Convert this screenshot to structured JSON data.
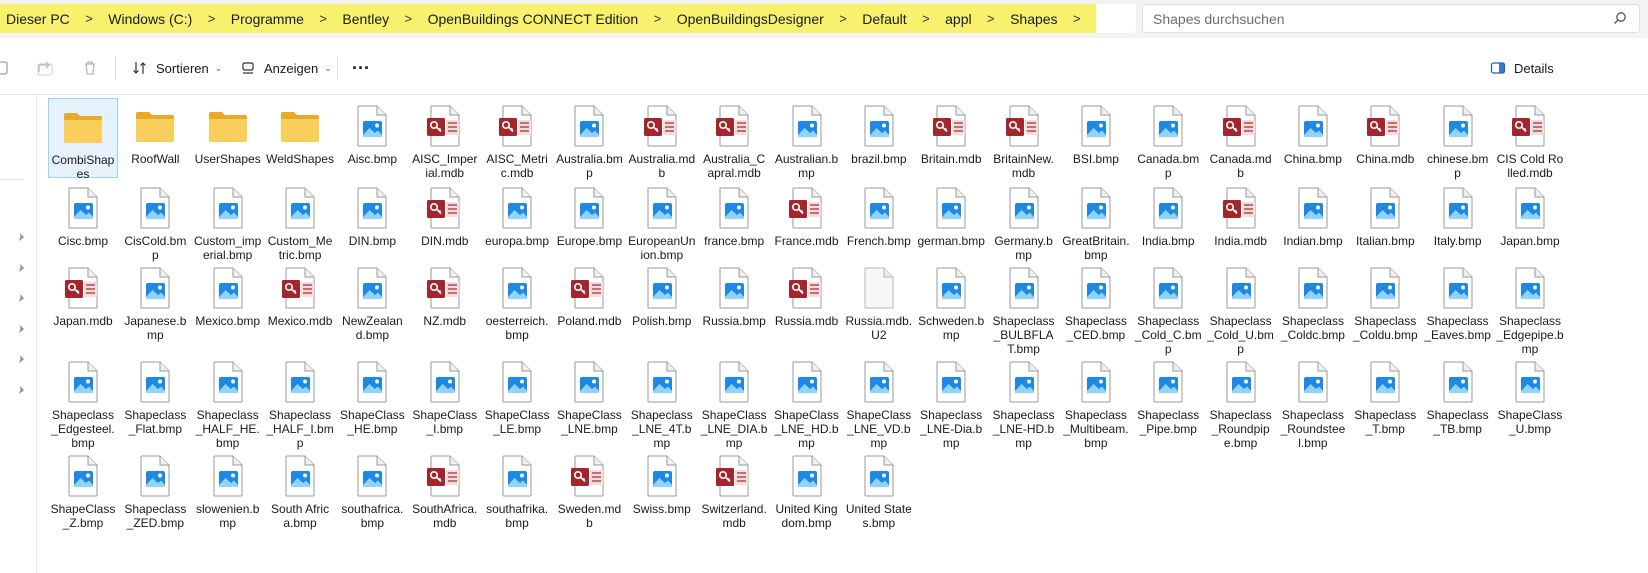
{
  "breadcrumb": [
    "Dieser PC",
    "Windows  (C:)",
    "Programme",
    "Bentley",
    "OpenBuildings CONNECT Edition",
    "OpenBuildingsDesigner",
    "Default",
    "appl",
    "Shapes"
  ],
  "search": {
    "placeholder": "Shapes durchsuchen"
  },
  "toolbar": {
    "sort_label": "Sortieren",
    "view_label": "Anzeigen",
    "more_label": "···",
    "details_label": "Details"
  },
  "colors": {
    "breadcrumb_highlight": "#f7f16d",
    "selected_bg": "#e5f1fb",
    "folder": "#f5c448",
    "image_icon": "#1e88e5",
    "mdb_icon": "#a4262c"
  },
  "files": [
    {
      "name": "CombiShapes",
      "type": "folder"
    },
    {
      "name": "RoofWall",
      "type": "folder"
    },
    {
      "name": "UserShapes",
      "type": "folder"
    },
    {
      "name": "WeldShapes",
      "type": "folder"
    },
    {
      "name": "Aisc.bmp",
      "type": "image"
    },
    {
      "name": "AISC_Imperial.mdb",
      "type": "mdb"
    },
    {
      "name": "AISC_Metric.mdb",
      "type": "mdb"
    },
    {
      "name": "Australia.bmp",
      "type": "image"
    },
    {
      "name": "Australia.mdb",
      "type": "mdb"
    },
    {
      "name": "Australia_Capral.mdb",
      "type": "mdb"
    },
    {
      "name": "Australian.bmp",
      "type": "image"
    },
    {
      "name": "brazil.bmp",
      "type": "image"
    },
    {
      "name": "Britain.mdb",
      "type": "mdb"
    },
    {
      "name": "BritainNew.mdb",
      "type": "mdb"
    },
    {
      "name": "BSI.bmp",
      "type": "image"
    },
    {
      "name": "Canada.bmp",
      "type": "image"
    },
    {
      "name": "Canada.mdb",
      "type": "mdb"
    },
    {
      "name": "China.bmp",
      "type": "image"
    },
    {
      "name": "China.mdb",
      "type": "mdb"
    },
    {
      "name": "chinese.bmp",
      "type": "image"
    },
    {
      "name": "CIS Cold Rolled.mdb",
      "type": "mdb"
    },
    {
      "name": "Cisc.bmp",
      "type": "image"
    },
    {
      "name": "CisCold.bmp",
      "type": "image"
    },
    {
      "name": "Custom_imperial.bmp",
      "type": "image"
    },
    {
      "name": "Custom_Metric.bmp",
      "type": "image"
    },
    {
      "name": "DIN.bmp",
      "type": "image"
    },
    {
      "name": "DIN.mdb",
      "type": "mdb"
    },
    {
      "name": "europa.bmp",
      "type": "image"
    },
    {
      "name": "Europe.bmp",
      "type": "image"
    },
    {
      "name": "EuropeanUnion.bmp",
      "type": "image"
    },
    {
      "name": "france.bmp",
      "type": "image"
    },
    {
      "name": "France.mdb",
      "type": "mdb"
    },
    {
      "name": "French.bmp",
      "type": "image"
    },
    {
      "name": "german.bmp",
      "type": "image"
    },
    {
      "name": "Germany.bmp",
      "type": "image"
    },
    {
      "name": "GreatBritain.bmp",
      "type": "image"
    },
    {
      "name": "India.bmp",
      "type": "image"
    },
    {
      "name": "India.mdb",
      "type": "mdb"
    },
    {
      "name": "Indian.bmp",
      "type": "image"
    },
    {
      "name": "Italian.bmp",
      "type": "image"
    },
    {
      "name": "Italy.bmp",
      "type": "image"
    },
    {
      "name": "Japan.bmp",
      "type": "image"
    },
    {
      "name": "Japan.mdb",
      "type": "mdb"
    },
    {
      "name": "Japanese.bmp",
      "type": "image"
    },
    {
      "name": "Mexico.bmp",
      "type": "image"
    },
    {
      "name": "Mexico.mdb",
      "type": "mdb"
    },
    {
      "name": "NewZealand.bmp",
      "type": "image"
    },
    {
      "name": "NZ.mdb",
      "type": "mdb"
    },
    {
      "name": "oesterreich.bmp",
      "type": "image"
    },
    {
      "name": "Poland.mdb",
      "type": "mdb"
    },
    {
      "name": "Polish.bmp",
      "type": "image"
    },
    {
      "name": "Russia.bmp",
      "type": "image"
    },
    {
      "name": "Russia.mdb",
      "type": "mdb"
    },
    {
      "name": "Russia.mdb.U2",
      "type": "blank"
    },
    {
      "name": "Schweden.bmp",
      "type": "image"
    },
    {
      "name": "Shapeclass_BULBFLAT.bmp",
      "type": "image"
    },
    {
      "name": "Shapeclass_CED.bmp",
      "type": "image"
    },
    {
      "name": "Shapeclass_Cold_C.bmp",
      "type": "image"
    },
    {
      "name": "Shapeclass_Cold_U.bmp",
      "type": "image"
    },
    {
      "name": "Shapeclass_Coldc.bmp",
      "type": "image"
    },
    {
      "name": "Shapeclass_Coldu.bmp",
      "type": "image"
    },
    {
      "name": "Shapeclass_Eaves.bmp",
      "type": "image"
    },
    {
      "name": "Shapeclass_Edgepipe.bmp",
      "type": "image"
    },
    {
      "name": "Shapeclass_Edgesteel.bmp",
      "type": "image"
    },
    {
      "name": "Shapeclass_Flat.bmp",
      "type": "image"
    },
    {
      "name": "Shapeclass_HALF_HE.bmp",
      "type": "image"
    },
    {
      "name": "Shapeclass_HALF_I.bmp",
      "type": "image"
    },
    {
      "name": "ShapeClass_HE.bmp",
      "type": "image"
    },
    {
      "name": "ShapeClass_I.bmp",
      "type": "image"
    },
    {
      "name": "ShapeClass_LE.bmp",
      "type": "image"
    },
    {
      "name": "ShapeClass_LNE.bmp",
      "type": "image"
    },
    {
      "name": "Shapeclass_LNE_4T.bmp",
      "type": "image"
    },
    {
      "name": "ShapeClass_LNE_DIA.bmp",
      "type": "image"
    },
    {
      "name": "ShapeClass_LNE_HD.bmp",
      "type": "image"
    },
    {
      "name": "ShapeClass_LNE_VD.bmp",
      "type": "image"
    },
    {
      "name": "Shapeclass_LNE-Dia.bmp",
      "type": "image"
    },
    {
      "name": "Shapeclass_LNE-HD.bmp",
      "type": "image"
    },
    {
      "name": "Shapeclass_Multibeam.bmp",
      "type": "image"
    },
    {
      "name": "Shapeclass_Pipe.bmp",
      "type": "image"
    },
    {
      "name": "Shapeclass_Roundpipe.bmp",
      "type": "image"
    },
    {
      "name": "Shapeclass_Roundsteel.bmp",
      "type": "image"
    },
    {
      "name": "Shapeclass_T.bmp",
      "type": "image"
    },
    {
      "name": "Shapeclass_TB.bmp",
      "type": "image"
    },
    {
      "name": "ShapeClass_U.bmp",
      "type": "image"
    },
    {
      "name": "ShapeClass_Z.bmp",
      "type": "image"
    },
    {
      "name": "Shapeclass_ZED.bmp",
      "type": "image"
    },
    {
      "name": "slowenien.bmp",
      "type": "image"
    },
    {
      "name": "South Africa.bmp",
      "type": "image"
    },
    {
      "name": "southafrica.bmp",
      "type": "image"
    },
    {
      "name": "SouthAfrica.mdb",
      "type": "mdb"
    },
    {
      "name": "southafrika.bmp",
      "type": "image"
    },
    {
      "name": "Sweden.mdb",
      "type": "mdb"
    },
    {
      "name": "Swiss.bmp",
      "type": "image"
    },
    {
      "name": "Switzerland.mdb",
      "type": "mdb"
    },
    {
      "name": "United Kingdom.bmp",
      "type": "image"
    },
    {
      "name": "United States.bmp",
      "type": "image"
    }
  ]
}
